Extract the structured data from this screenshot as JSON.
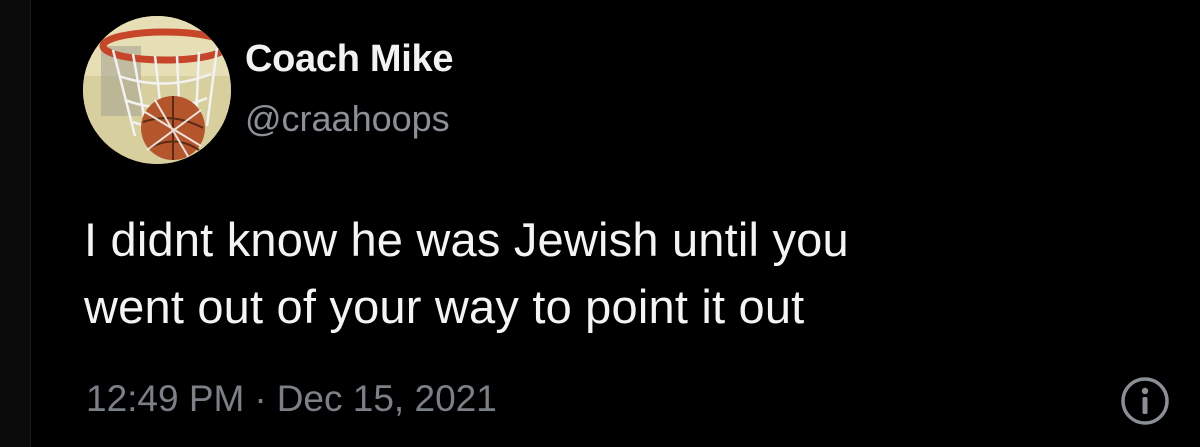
{
  "tweet": {
    "author": {
      "display_name": "Coach Mike",
      "handle": "@craahoops",
      "avatar_icon": "basketball-hoop-avatar"
    },
    "text_line1": "I didnt know he was Jewish until you",
    "text_line2": "went out of your way to point it out",
    "time": "12:49 PM",
    "separator": "·",
    "date": "Dec 15, 2021",
    "info_icon": "info-icon"
  },
  "theme": {
    "background": "#000000",
    "text_primary": "#f4f4f4",
    "text_secondary": "#7b8086"
  }
}
